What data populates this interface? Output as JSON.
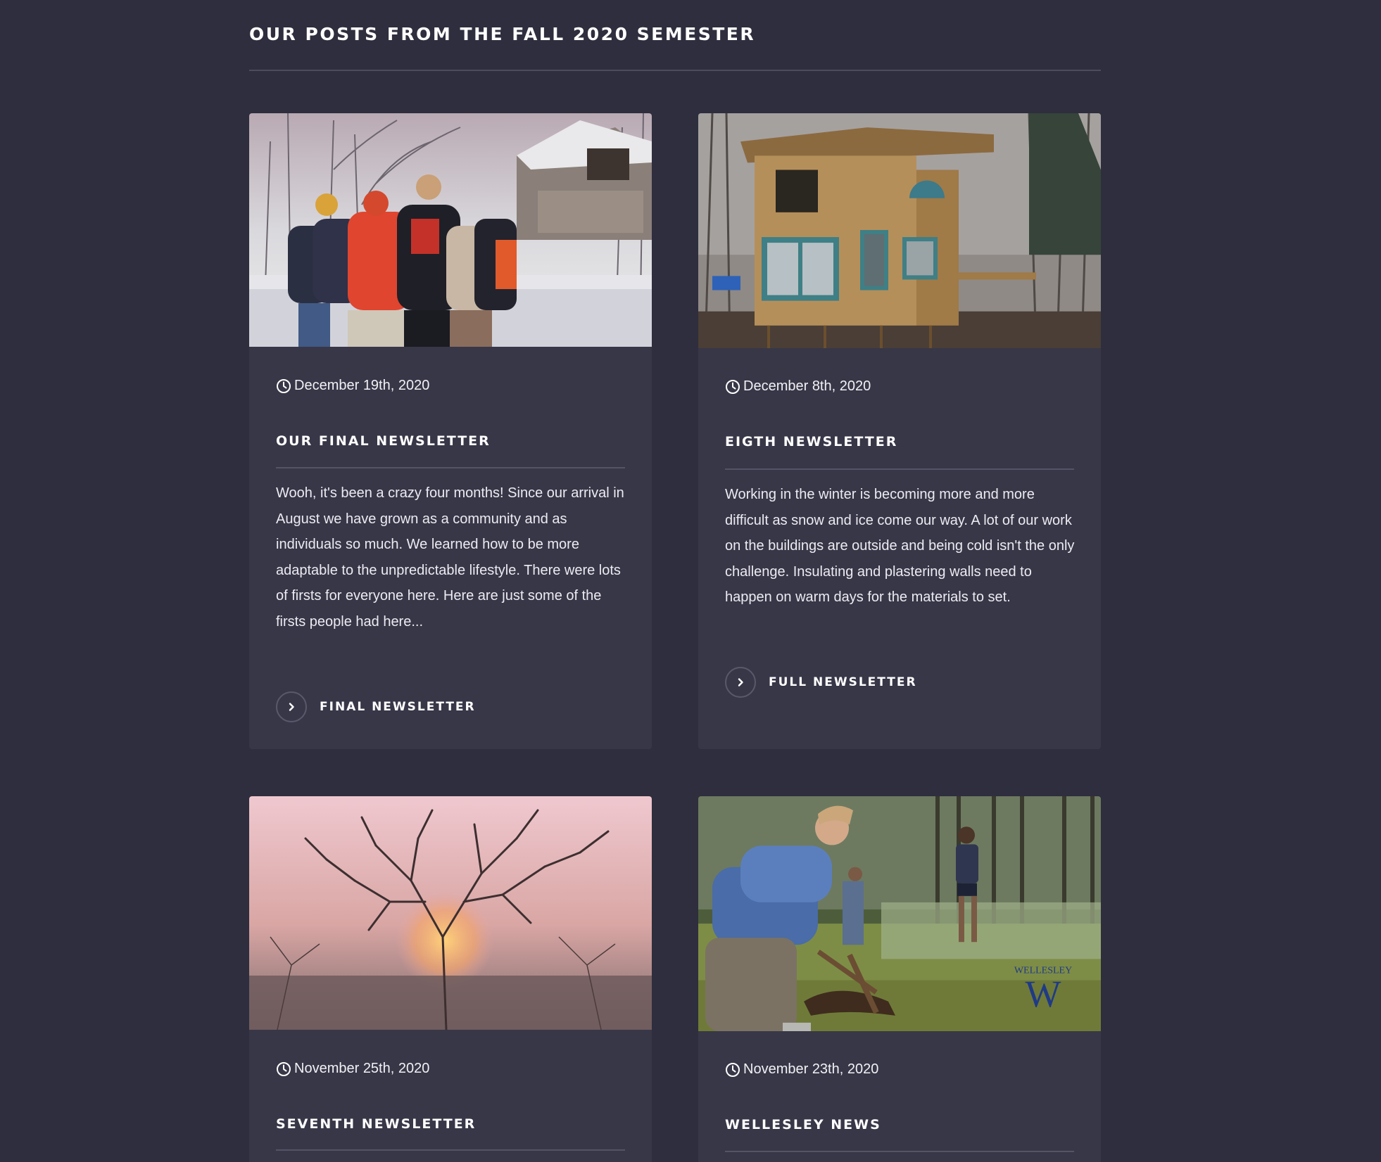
{
  "section": {
    "title": "OUR POSTS FROM THE FALL 2020 SEMESTER"
  },
  "posts": [
    {
      "image": "group-hug-in-snow-photo",
      "date": "December 19th, 2020",
      "title": "OUR FINAL NEWSLETTER",
      "excerpt": "Wooh, it's been a crazy four months! Since our arrival in August we have grown as a community and as individuals so much. We learned how to be more adaptable to the unpredictable lifestyle. There were lots of firsts for everyone here. Here are just some of the firsts people had here...",
      "link_label": "FINAL NEWSLETTER"
    },
    {
      "image": "wooden-cabin-construction-photo",
      "date": "December 8th, 2020",
      "title": "EIGTH NEWSLETTER",
      "excerpt": "Working in the winter is becoming more and more difficult as snow and ice come our way. A lot of our work on the buildings are outside and being cold isn't the only challenge. Insulating and plastering walls need to happen on warm days for the materials to set.",
      "link_label": "FULL NEWSLETTER"
    },
    {
      "image": "sunset-behind-bare-trees-photo",
      "date": "November 25th, 2020",
      "title": "SEVENTH NEWSLETTER"
    },
    {
      "image": "digging-in-forest-clearing-photo",
      "date": "November 23th, 2020",
      "title": "WELLESLEY NEWS",
      "image_logo_text": "WELLESLEY"
    }
  ],
  "icons": {
    "date": "clock-icon",
    "link": "chevron-right-icon"
  },
  "colors": {
    "page_background": "#2e2e3e",
    "card_background": "#383748",
    "divider": "#555466",
    "text": "#ffffff"
  }
}
